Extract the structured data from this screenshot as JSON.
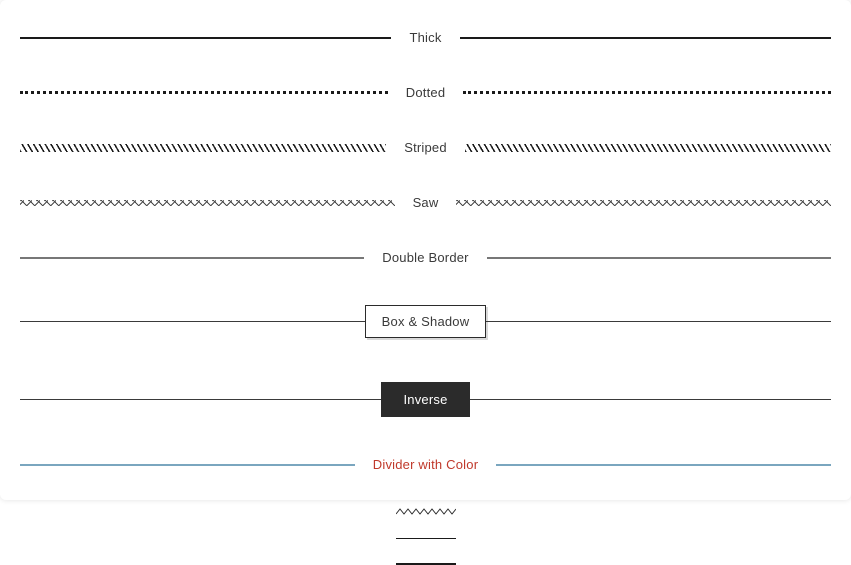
{
  "dividers": {
    "thick": {
      "label": "Thick"
    },
    "dotted": {
      "label": "Dotted"
    },
    "striped": {
      "label": "Striped"
    },
    "saw": {
      "label": "Saw"
    },
    "double": {
      "label": "Double Border"
    },
    "boxshadow": {
      "label": "Box & Shadow"
    },
    "inverse": {
      "label": "Inverse"
    },
    "color": {
      "label": "Divider with Color",
      "line_color": "#7aa6bf",
      "label_color": "#c0392b"
    }
  }
}
